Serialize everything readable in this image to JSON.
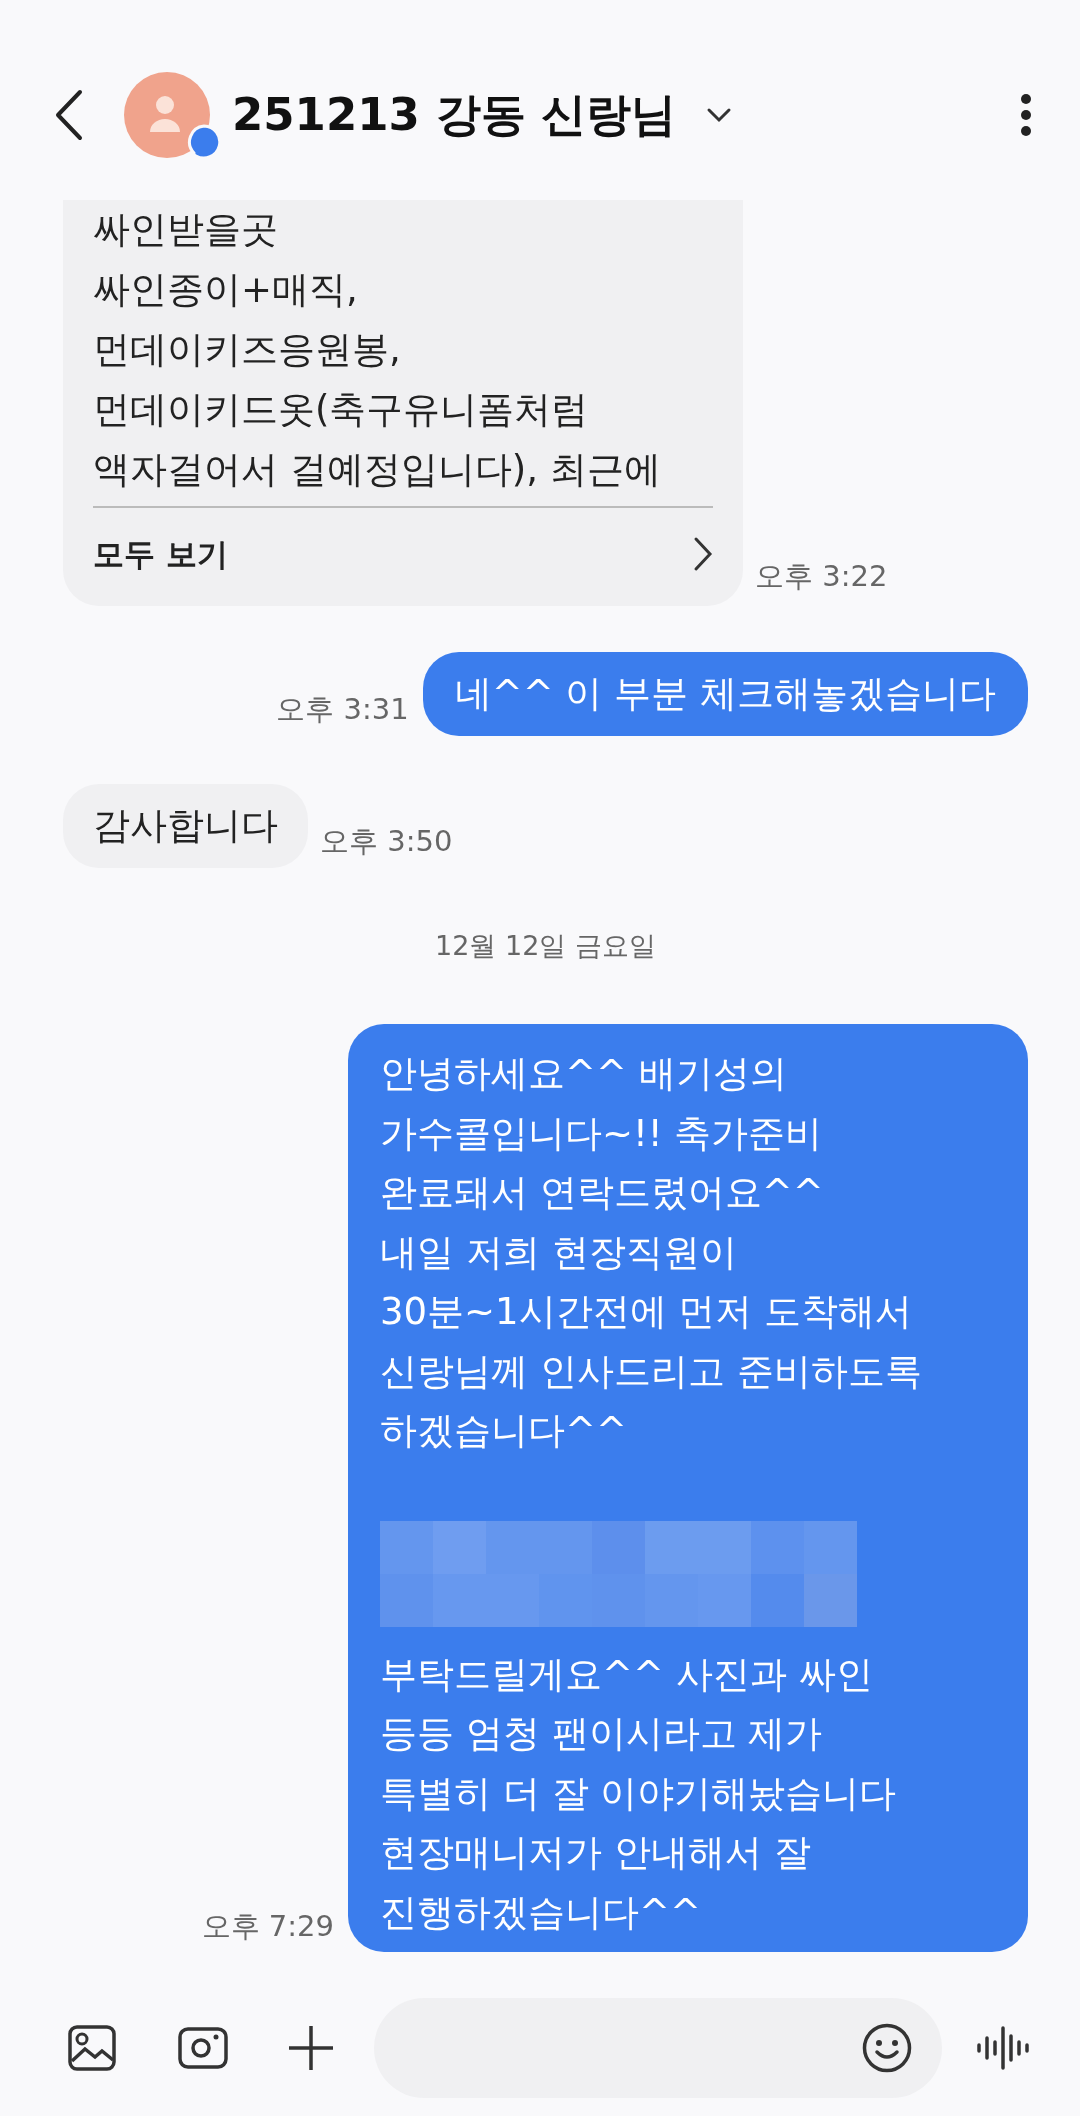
{
  "header": {
    "title": "251213 강동 신랑님"
  },
  "messages": [
    {
      "kind": "incoming_preview",
      "text": "싸인받을곳\n싸인종이+매직,\n먼데이키즈응원봉,\n먼데이키드옷(축구유니폼처럼\n액자걸어서 걸예정입니다), 최근에",
      "action": "모두 보기",
      "time": "오후 3:22"
    },
    {
      "kind": "outgoing",
      "parts": [
        {
          "kind": "text",
          "text": "네^^ 이 부분 체크해놓겠습니다"
        }
      ],
      "time": "오후 3:31"
    },
    {
      "kind": "incoming",
      "parts": [
        {
          "kind": "text",
          "text": "감사합니다"
        }
      ],
      "time": "오후 3:50"
    },
    {
      "kind": "date",
      "text": "12월 12일 금요일"
    },
    {
      "kind": "outgoing",
      "parts": [
        {
          "kind": "text",
          "text": "안녕하세요^^ 배기성의\n가수콜입니다~!! 축가준비\n완료돼서 연락드렸어요^^\n내일 저희 현장직원이\n30분~1시간전에 먼저 도착해서\n신랑님께 인사드리고 준비하도록\n하겠습니다^^"
        },
        {
          "kind": "redacted"
        },
        {
          "kind": "text",
          "text": "부탁드릴게요^^ 사진과 싸인\n등등 엄청 팬이시라고 제가\n특별히 더 잘 이야기해놨습니다\n현장매니저가 안내해서 잘\n진행하겠습니다^^"
        }
      ],
      "time": "오후 7:29"
    }
  ]
}
